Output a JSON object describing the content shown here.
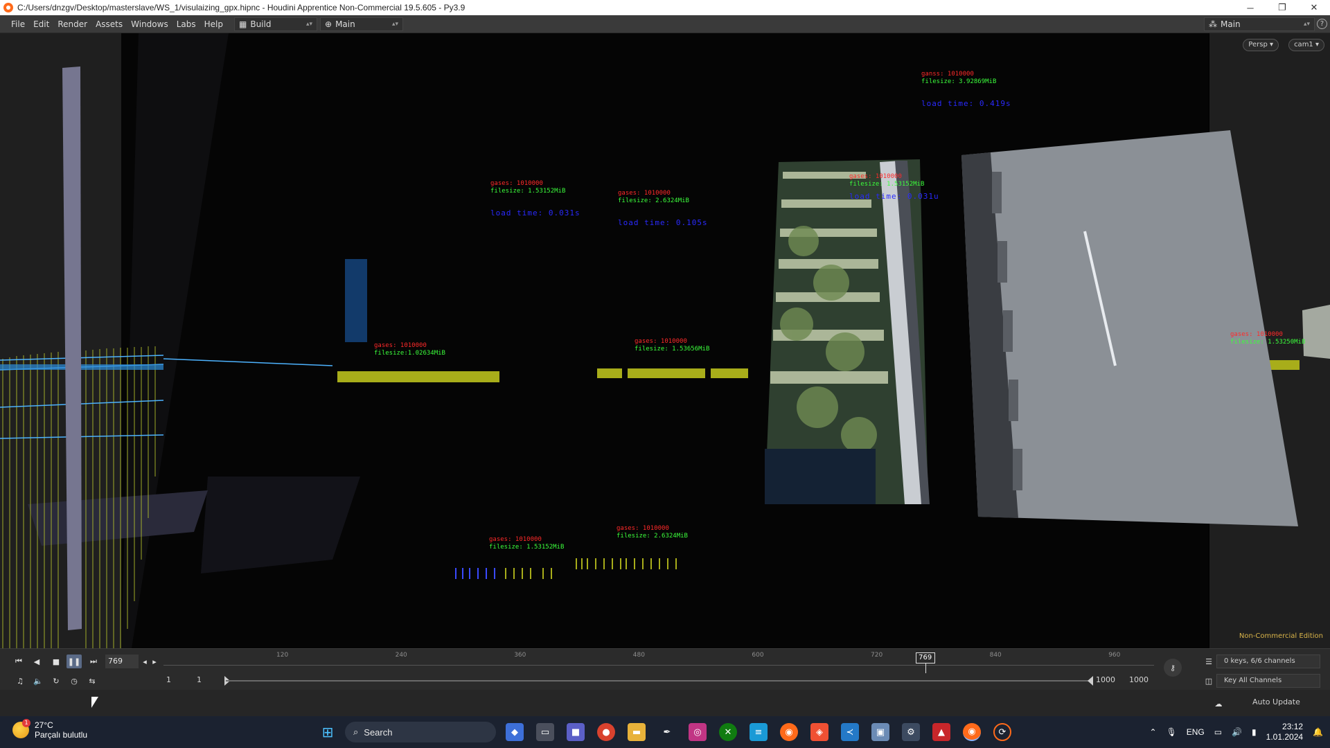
{
  "window": {
    "title": "C:/Users/dnzgv/Desktop/masterslave/WS_1/visulaizing_gpx.hipnc - Houdini Apprentice Non-Commercial 19.5.605 - Py3.9",
    "minimize": "─",
    "maximize": "❐",
    "close": "✕"
  },
  "menu": {
    "items": [
      "File",
      "Edit",
      "Render",
      "Assets",
      "Windows",
      "Labs",
      "Help"
    ],
    "desktop_left": "Build",
    "desktop_mid": "Main",
    "desktop_right": "Main",
    "help": "?"
  },
  "viewport": {
    "camera_menu": "Persp ▾",
    "cam_menu": "cam1 ▾",
    "edition_label": "Non-Commercial Edition",
    "hud_labels": [
      {
        "red": "ganss: 1010000",
        "green": "filesize: 3.92869MiB",
        "blue": "load time: 0.419s"
      },
      {
        "red": "gases: 1010000",
        "green": "filesize: 1.53152MiB",
        "blue": "load time: 0.031s"
      },
      {
        "red": "gases: 1010000",
        "green": "filesize: 2.6324MiB",
        "blue": "load time: 0.105s"
      },
      {
        "red": "gases: 1010000",
        "green": "filesize: 1.53152MiB",
        "blue": "load time: 0.031u"
      },
      {
        "red": "gases: 1010000",
        "green": "filesize:1.02634MiB",
        "blue": ""
      },
      {
        "red": "gases: 1010000",
        "green": "filesize: 1.53656MiB",
        "blue": ""
      },
      {
        "red": "gases: 1010000",
        "green": "filesize: 1.53152MiB",
        "blue": ""
      },
      {
        "red": "gases: 1010000",
        "green": "filesize: 2.6324MiB",
        "blue": ""
      },
      {
        "red": "gases: 1010000",
        "green": "filesize: 1.53250MiB",
        "blue": ""
      }
    ]
  },
  "timeline": {
    "current_frame": "769",
    "ticks": [
      "120",
      "240",
      "360",
      "480",
      "600",
      "720",
      "840",
      "960"
    ],
    "marker": "769",
    "start_a": "1",
    "start_b": "1",
    "end_a": "1000",
    "end_b": "1000",
    "channels": "0 keys, 6/6 channels",
    "key_all": "Key All Channels",
    "progress": 0.769
  },
  "status": {
    "auto_update": "Auto Update"
  },
  "taskbar": {
    "temperature": "27°C",
    "weather": "Parçalı bulutlu",
    "weather_badge": "1",
    "search": "Search",
    "language": "ENG",
    "time": "23:12",
    "date": "1.01.2024"
  },
  "colors": {
    "accent": "#5a6a86",
    "hud_red": "#ff2a2a",
    "hud_green": "#3cff3c",
    "hud_blue": "#2a2aff",
    "gpx_yellow": "#a8ad1a",
    "edition": "#d9b44a"
  }
}
